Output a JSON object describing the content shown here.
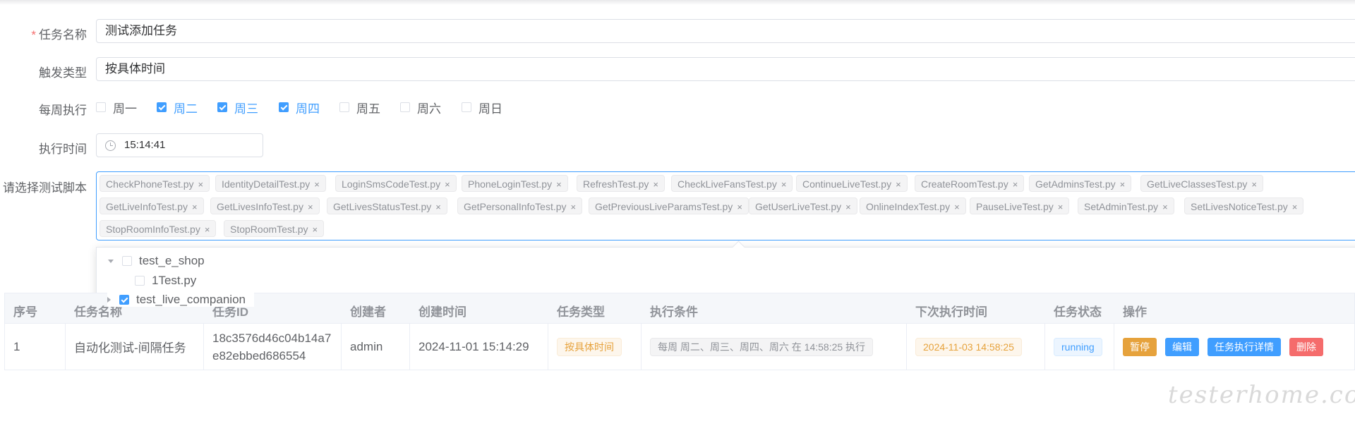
{
  "form": {
    "task_name": {
      "label": "任务名称",
      "required_mark": "*",
      "value": "测试添加任务"
    },
    "trigger_type": {
      "label": "触发类型",
      "value": "按具体时间"
    },
    "weekly": {
      "label": "每周执行",
      "days": [
        {
          "label": "周一",
          "checked": false
        },
        {
          "label": "周二",
          "checked": true
        },
        {
          "label": "周三",
          "checked": true
        },
        {
          "label": "周四",
          "checked": true
        },
        {
          "label": "周五",
          "checked": false
        },
        {
          "label": "周六",
          "checked": false
        },
        {
          "label": "周日",
          "checked": false
        }
      ]
    },
    "exec_time": {
      "label": "执行时间",
      "value": "15:14:41",
      "icon": "clock-icon"
    },
    "scripts": {
      "label": "请选择测试脚本",
      "tags": [
        "CheckPhoneTest.py",
        "IdentityDetailTest.py",
        "LoginSmsCodeTest.py",
        "PhoneLoginTest.py",
        "RefreshTest.py",
        "CheckLiveFansTest.py",
        "ContinueLiveTest.py",
        "CreateRoomTest.py",
        "GetAdminsTest.py",
        "GetLiveClassesTest.py",
        "GetLiveInfoTest.py",
        "GetLivesInfoTest.py",
        "GetLivesStatusTest.py",
        "GetPersonalInfoTest.py",
        "GetPreviousLiveParamsTest.py",
        "GetUserLiveTest.py",
        "OnlineIndexTest.py",
        "PauseLiveTest.py",
        "SetAdminTest.py",
        "SetLivesNoticeTest.py",
        "StopRoomInfoTest.py",
        "StopRoomTest.py"
      ],
      "close_glyph": "×"
    },
    "tree": [
      {
        "label": "test_e_shop",
        "checked": false,
        "expanded": true
      },
      {
        "label": "1Test.py",
        "checked": false,
        "child": true
      },
      {
        "label": "test_live_companion",
        "checked": true,
        "expanded": false
      }
    ]
  },
  "table": {
    "headers": [
      "序号",
      "任务名称",
      "任务ID",
      "创建者",
      "创建时间",
      "任务类型",
      "执行条件",
      "下次执行时间",
      "任务状态",
      "操作"
    ],
    "rows": [
      {
        "index": "1",
        "name": "自动化测试-间隔任务",
        "task_id": "18c3576d46c04b14a7e82ebbed686554",
        "creator": "admin",
        "created_at": "2024-11-01 15:14:29",
        "type": "按具体时间",
        "condition": "每周 周二、周三、周四、周六 在 14:58:25 执行",
        "next_run": "2024-11-03 14:58:25",
        "status": "running",
        "actions": [
          "暂停",
          "编辑",
          "任务执行详情",
          "删除"
        ]
      }
    ]
  },
  "watermark": "testerhome.com",
  "colors": {
    "primary": "#409eff",
    "warning": "#e6a23c",
    "danger": "#f56c6c",
    "required": "#f56c6c"
  }
}
